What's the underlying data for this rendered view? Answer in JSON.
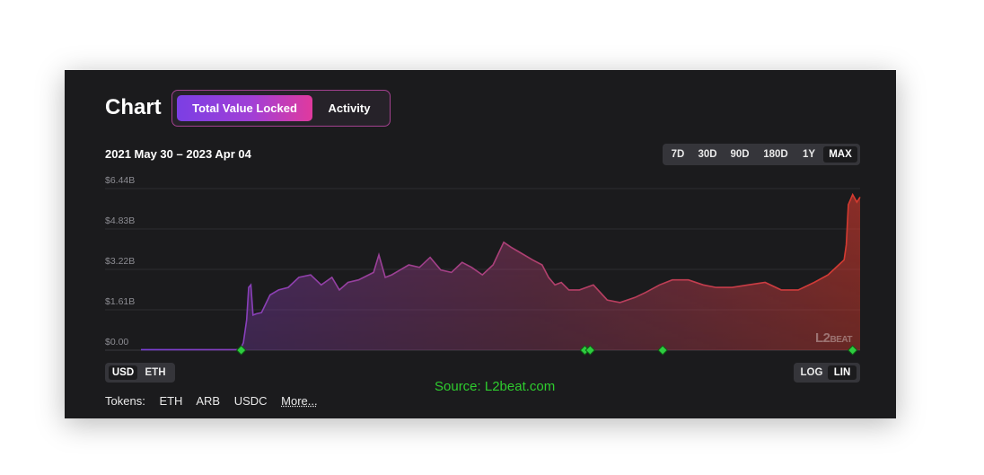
{
  "header": {
    "title": "Chart",
    "tabs": [
      {
        "label": "Total Value Locked",
        "active": true
      },
      {
        "label": "Activity",
        "active": false
      }
    ]
  },
  "date_range": "2021 May 30 – 2023 Apr 04",
  "range_buttons": [
    "7D",
    "30D",
    "90D",
    "180D",
    "1Y",
    "MAX"
  ],
  "range_selected": "MAX",
  "currency_toggle": {
    "options": [
      "USD",
      "ETH"
    ],
    "selected": "USD"
  },
  "scale_toggle": {
    "options": [
      "LOG",
      "LIN"
    ],
    "selected": "LIN"
  },
  "source_text": "Source: L2beat.com",
  "tokens": {
    "label": "Tokens:",
    "items": [
      "ETH",
      "ARB",
      "USDC"
    ],
    "more": "More..."
  },
  "watermark": {
    "big": "L2",
    "small": "BEAT"
  },
  "colors": {
    "start": "#7a3fd6",
    "mid": "#b0406f",
    "end": "#d63a2e",
    "marker": "#2ecc40",
    "source": "#2ecc2e"
  },
  "chart_data": {
    "type": "area",
    "y_tick_labels": [
      "$0.00",
      "$1.61B",
      "$3.22B",
      "$4.83B",
      "$6.44B"
    ],
    "ylim": [
      0,
      6.44
    ],
    "unit": "USD billions",
    "xlim": [
      "2021-05-30",
      "2023-04-04"
    ],
    "x": [
      "2021-05-30",
      "2021-07-01",
      "2021-08-01",
      "2021-08-31",
      "2021-09-03",
      "2021-09-06",
      "2021-09-08",
      "2021-09-10",
      "2021-09-12",
      "2021-09-15",
      "2021-09-20",
      "2021-09-28",
      "2021-10-06",
      "2021-10-15",
      "2021-10-25",
      "2021-11-05",
      "2021-11-15",
      "2021-11-25",
      "2021-12-02",
      "2021-12-10",
      "2021-12-20",
      "2022-01-03",
      "2022-01-08",
      "2022-01-14",
      "2022-01-20",
      "2022-01-28",
      "2022-02-05",
      "2022-02-15",
      "2022-02-25",
      "2022-03-07",
      "2022-03-17",
      "2022-03-27",
      "2022-04-05",
      "2022-04-15",
      "2022-04-25",
      "2022-05-05",
      "2022-05-12",
      "2022-05-20",
      "2022-06-01",
      "2022-06-10",
      "2022-06-16",
      "2022-06-22",
      "2022-06-28",
      "2022-07-05",
      "2022-07-15",
      "2022-07-28",
      "2022-08-10",
      "2022-08-22",
      "2022-09-05",
      "2022-09-15",
      "2022-09-28",
      "2022-10-10",
      "2022-10-25",
      "2022-11-08",
      "2022-11-20",
      "2022-12-05",
      "2022-12-20",
      "2023-01-05",
      "2023-01-20",
      "2023-02-05",
      "2023-02-20",
      "2023-03-05",
      "2023-03-15",
      "2023-03-20",
      "2023-03-22",
      "2023-03-24",
      "2023-03-28",
      "2023-04-01",
      "2023-04-04"
    ],
    "series": [
      {
        "values": [
          0.02,
          0.02,
          0.02,
          0.02,
          0.3,
          1.2,
          2.5,
          2.6,
          1.4,
          1.45,
          1.5,
          2.2,
          2.4,
          2.5,
          2.9,
          3.0,
          2.6,
          2.9,
          2.4,
          2.7,
          2.8,
          3.1,
          3.8,
          2.9,
          3.0,
          3.2,
          3.4,
          3.3,
          3.7,
          3.2,
          3.1,
          3.5,
          3.3,
          3.0,
          3.4,
          4.3,
          4.1,
          3.9,
          3.6,
          3.4,
          2.9,
          2.6,
          2.7,
          2.4,
          2.4,
          2.6,
          2.0,
          1.9,
          2.1,
          2.3,
          2.6,
          2.8,
          2.8,
          2.6,
          2.5,
          2.5,
          2.6,
          2.7,
          2.4,
          2.4,
          2.7,
          3.0,
          3.4,
          3.6,
          4.2,
          5.8,
          6.2,
          5.9,
          6.1
        ]
      }
    ],
    "markers_x": [
      "2021-09-01",
      "2022-07-20",
      "2022-07-25",
      "2022-10-01",
      "2023-03-28"
    ],
    "legend": "none",
    "grid": true
  }
}
